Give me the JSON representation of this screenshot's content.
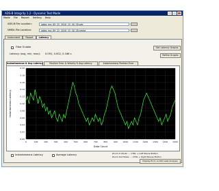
{
  "window": {
    "title": "ADS-B Integrity 1.2 - Dynamic Test Mode",
    "menu": [
      "Mode",
      "File",
      "Report",
      "Setting",
      "Help"
    ]
  },
  "files": {
    "adsb_label": "ADS-B File Location:",
    "adsb_value": "ipbtg_mg_09_22_2010_15_40_28.pdc",
    "nmea_label": "NMEA File Location:",
    "nmea_value": "ipbtg_mg_09_22_2010_15_40_28.nmea"
  },
  "tabs": [
    "Instrument",
    "Report",
    "Latency"
  ],
  "active_tab": "Latency",
  "panel": {
    "filter_label": "Filter Enable",
    "latency_label": "Latency (avg, min, max):",
    "latency_value": "0.091, 0.002, 0.186 s",
    "btn_get_latency": "Get Latency Graphs",
    "btn_refine": "Refine Graphs"
  },
  "subtabs": [
    "Instantaneous & Avg Latency",
    "Position Error & Velocity & Avg Latency",
    "Instantaneous Position Error"
  ],
  "active_subtab": "Instantaneous & Avg Latency",
  "legend": {
    "inst_label": "Instantaneous Latency",
    "avg_label": "Average Latency"
  },
  "info": {
    "line1": "Zoom In Mode: ... CTRL + Left Mouse Button",
    "line2": "Zoom Out Mode: ... CTRL + Right Mouse Button"
  },
  "bottom_button": "Display Error vs Poll Lead Analysis",
  "colors": {
    "plot_bg": "#000000",
    "series": "#33ff33",
    "grid": "#2a2a2a"
  },
  "chart_data": {
    "type": "line",
    "xlabel": "Data Count",
    "ylabel": "Instantaneous Latency",
    "ylim": [
      0.0,
      0.2
    ],
    "y_ticks": [
      "0.20",
      "0.18",
      "0.16",
      "0.14",
      "0.12",
      "0.10",
      "0.08",
      "0.06",
      "0.04",
      "0.02",
      "0.00"
    ],
    "x_ticks": [
      "0",
      "100",
      "200",
      "300",
      "400",
      "500",
      "600",
      "700",
      "800",
      "900",
      "1000",
      "1100",
      "1200",
      "1300",
      "1400",
      "1500"
    ],
    "series": [
      {
        "values": [
          0.11,
          0.12,
          0.1,
          0.13,
          0.12,
          0.11,
          0.14,
          0.12,
          0.1,
          0.12,
          0.11,
          0.09,
          0.1,
          0.08,
          0.09,
          0.07,
          0.08,
          0.06,
          0.07,
          0.08,
          0.06,
          0.05,
          0.07,
          0.06,
          0.05,
          0.07,
          0.06,
          0.08,
          0.1,
          0.12,
          0.14,
          0.16,
          0.15,
          0.13,
          0.12,
          0.1,
          0.09,
          0.08,
          0.07,
          0.06,
          0.05,
          0.06,
          0.04,
          0.05,
          0.06,
          0.05,
          0.07,
          0.06,
          0.05,
          0.06,
          0.04,
          0.05,
          0.07,
          0.08,
          0.1,
          0.12,
          0.14,
          0.15,
          0.14,
          0.13,
          0.11,
          0.09,
          0.08,
          0.07,
          0.06,
          0.05,
          0.04,
          0.05,
          0.03,
          0.04,
          0.05,
          0.04,
          0.06,
          0.05,
          0.04,
          0.06,
          0.07,
          0.09,
          0.11,
          0.12,
          0.13,
          0.12,
          0.11,
          0.1,
          0.09,
          0.08,
          0.07,
          0.06,
          0.05,
          0.06,
          0.04,
          0.05,
          0.06,
          0.07,
          0.05,
          0.06,
          0.07,
          0.09,
          0.1,
          0.11
        ]
      }
    ]
  }
}
